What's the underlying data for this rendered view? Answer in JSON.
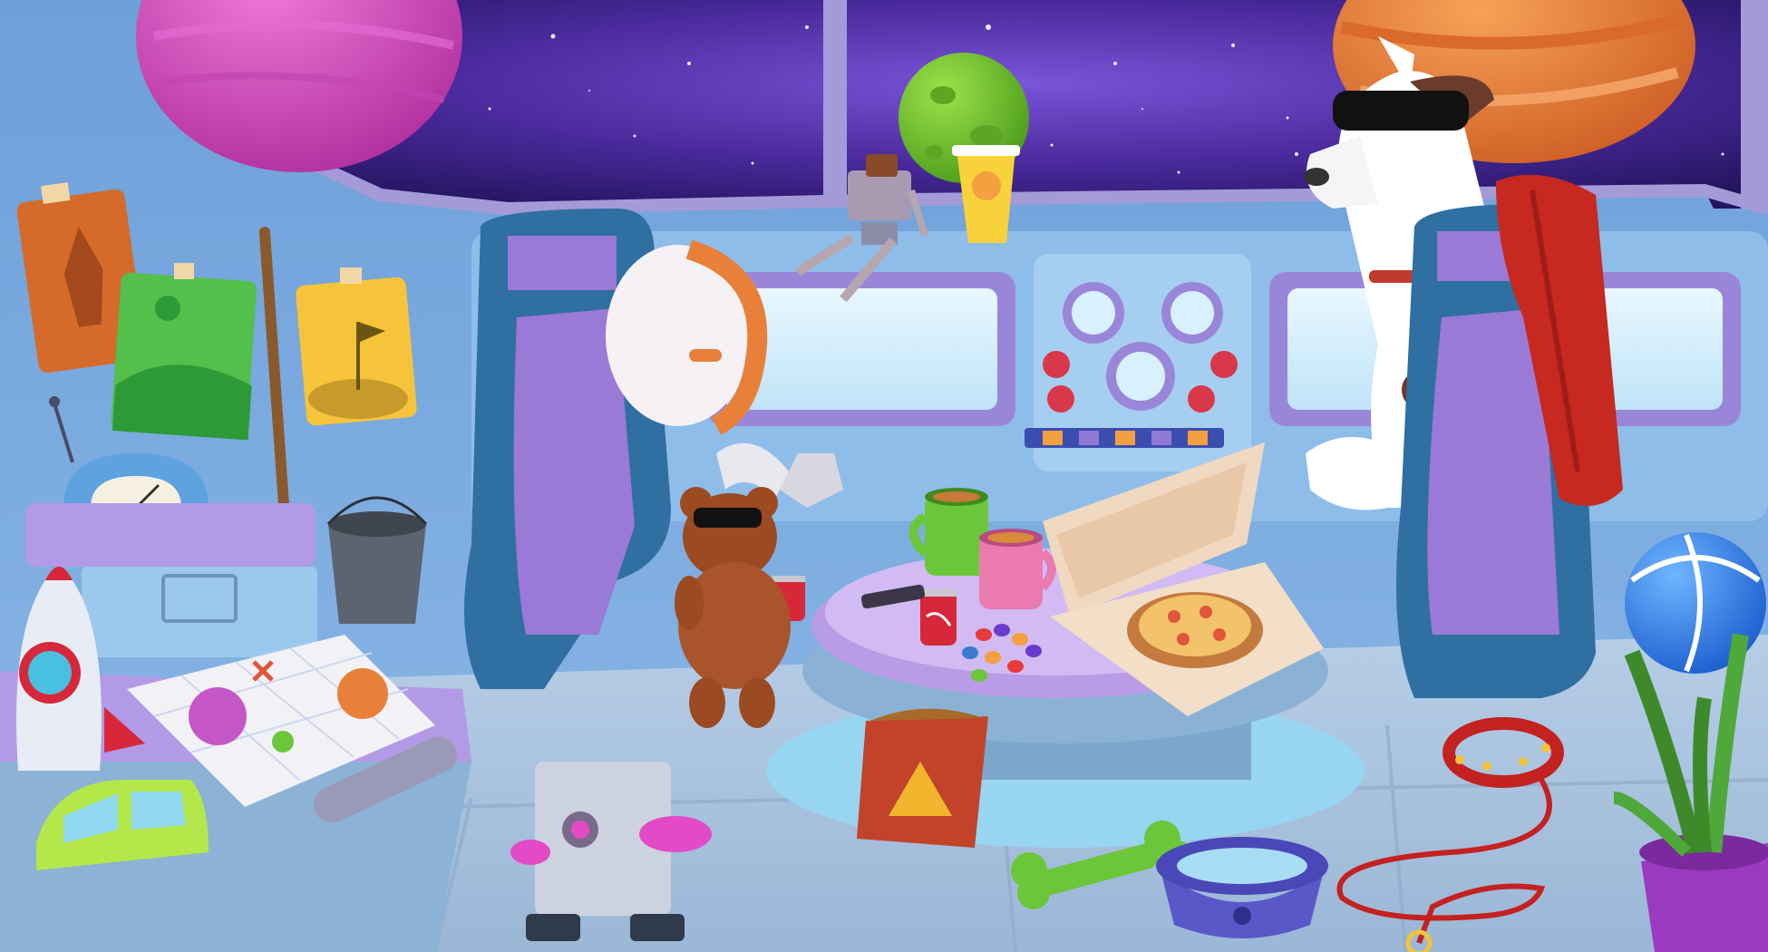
{
  "scene": {
    "setting": "spaceship-cockpit",
    "palette": {
      "space_top": "#2a1a6e",
      "space_mid": "#6b3fc9",
      "hull_blue": "#7fb0e6",
      "console_blue": "#9fc8ee",
      "seat_purple": "#9a7ad6",
      "seat_frame": "#2f6fa1",
      "floor": "#a9c3df",
      "table_purple": "#c7a9ef",
      "pink_planet": "#d44fc0",
      "orange_planet": "#e8803a",
      "green_planet": "#6ecb2f"
    },
    "objects": [
      {
        "id": "pink-planet",
        "icon": "planet-icon"
      },
      {
        "id": "green-planet",
        "icon": "planet-icon"
      },
      {
        "id": "orange-planet",
        "icon": "planet-icon"
      },
      {
        "id": "rocket-poster",
        "icon": "poster-icon"
      },
      {
        "id": "landscape-poster",
        "icon": "poster-icon"
      },
      {
        "id": "moon-flag-poster",
        "icon": "poster-icon"
      },
      {
        "id": "radio-gauge",
        "icon": "gauge-icon"
      },
      {
        "id": "metal-bucket",
        "icon": "bucket-icon"
      },
      {
        "id": "toy-rocket",
        "icon": "rocket-icon"
      },
      {
        "id": "star-map",
        "icon": "map-icon"
      },
      {
        "id": "toy-car",
        "icon": "car-icon"
      },
      {
        "id": "robot-box",
        "icon": "robot-icon"
      },
      {
        "id": "teddy-bear",
        "icon": "bear-icon"
      },
      {
        "id": "soda-can",
        "icon": "can-icon"
      },
      {
        "id": "green-mug",
        "icon": "mug-icon"
      },
      {
        "id": "pink-mug",
        "icon": "mug-icon"
      },
      {
        "id": "pizza-box",
        "icon": "pizza-icon"
      },
      {
        "id": "chips-bag",
        "icon": "chips-icon"
      },
      {
        "id": "candies",
        "icon": "candy-icon"
      },
      {
        "id": "dog-bone",
        "icon": "bone-icon"
      },
      {
        "id": "water-bowl",
        "icon": "bowl-icon"
      },
      {
        "id": "dog-leash",
        "icon": "leash-icon"
      },
      {
        "id": "beach-ball",
        "icon": "ball-icon"
      },
      {
        "id": "potted-plant",
        "icon": "plant-icon"
      },
      {
        "id": "floating-robot-toy",
        "icon": "robot-icon"
      },
      {
        "id": "juice-cup",
        "icon": "cup-icon"
      },
      {
        "id": "great-dane-dog",
        "icon": "dog-icon"
      },
      {
        "id": "astronaut-helmet",
        "icon": "helmet-icon"
      },
      {
        "id": "red-towel",
        "icon": "towel-icon"
      },
      {
        "id": "control-dials",
        "icon": "dial-icon"
      }
    ]
  }
}
